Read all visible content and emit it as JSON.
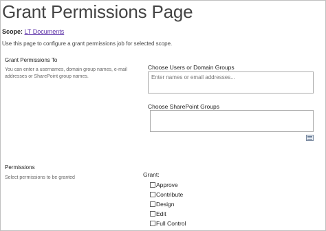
{
  "page": {
    "title": "Grant Permissions Page",
    "scope_label": "Scope:",
    "scope_link": "LT Documents",
    "intro": "Use this page to configure a grant permissions job for selected scope."
  },
  "grant_to": {
    "heading": "Grant Permissions To",
    "description": "You can enter a usernames, domain group names, e-mail addresses or SharePoint group names.",
    "users_label": "Choose Users or Domain Groups",
    "users_placeholder": "Enter names or email addresses...",
    "users_value": "",
    "sp_groups_label": "Choose SharePoint Groups",
    "sp_groups_value": "",
    "browse_icon": "browse-icon"
  },
  "permissions": {
    "heading": "Permissions",
    "description": "Select permissions to be granted",
    "grant_label": "Grant:",
    "items": [
      {
        "label": "Approve",
        "checked": false
      },
      {
        "label": "Contribute",
        "checked": false
      },
      {
        "label": "Design",
        "checked": false
      },
      {
        "label": "Edit",
        "checked": false
      },
      {
        "label": "Full Control",
        "checked": false
      }
    ]
  }
}
